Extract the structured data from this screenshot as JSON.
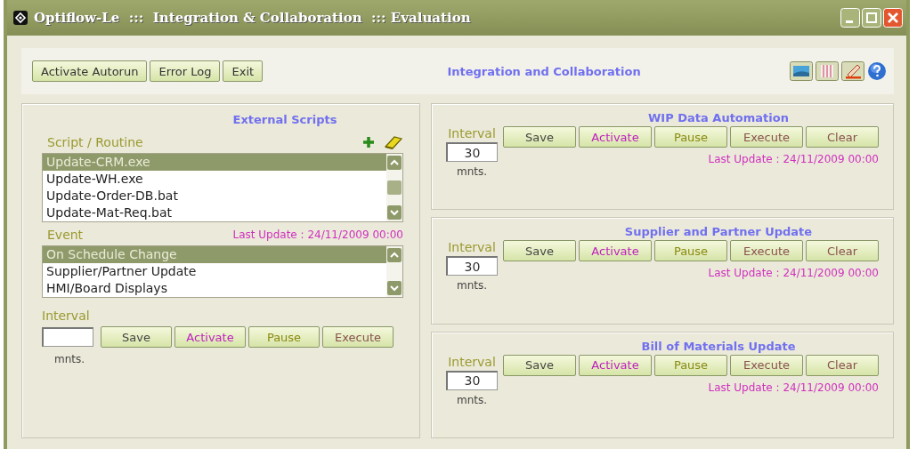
{
  "window": {
    "title": "Optiflow-Le  :::  Integration & Collaboration  ::: Evaluation"
  },
  "toolbar": {
    "buttons": [
      "Activate Autorun",
      "Error Log",
      "Exit"
    ],
    "heading": "Integration and Collaboration"
  },
  "external_scripts": {
    "title": "External Scripts",
    "list_label": "Script / Routine",
    "scripts": [
      {
        "label": "Update-CRM.exe",
        "selected": true
      },
      {
        "label": "Update-WH.exe",
        "selected": false
      },
      {
        "label": "Update-Order-DB.bat",
        "selected": false
      },
      {
        "label": "Update-Mat-Req.bat",
        "selected": false
      }
    ],
    "last_update": "Last Update : 24/11/2009 00:00",
    "event_label": "Event",
    "events": [
      {
        "label": "On Schedule Change",
        "selected": true
      },
      {
        "label": "Supplier/Partner Update",
        "selected": false
      },
      {
        "label": "HMI/Board Displays",
        "selected": false
      }
    ],
    "interval_label": "Interval",
    "unit": "mnts.",
    "buttons": [
      {
        "label": "Save",
        "kind": "save"
      },
      {
        "label": "Activate",
        "kind": "activate"
      },
      {
        "label": "Pause",
        "kind": "pause"
      },
      {
        "label": "Execute",
        "kind": "execute"
      }
    ]
  },
  "automations": [
    {
      "title": "WIP Data Automation",
      "interval_label": "Interval",
      "interval_value": "30",
      "unit": "mnts.",
      "last_update": "Last Update : 24/11/2009 00:00",
      "buttons": [
        {
          "label": "Save",
          "kind": "save"
        },
        {
          "label": "Activate",
          "kind": "activate"
        },
        {
          "label": "Pause",
          "kind": "pause"
        },
        {
          "label": "Execute",
          "kind": "execute"
        },
        {
          "label": "Clear",
          "kind": "clear"
        }
      ]
    },
    {
      "title": "Supplier and Partner Update",
      "interval_label": "Interval",
      "interval_value": "30",
      "unit": "mnts.",
      "last_update": "Last Update : 24/11/2009 00:00",
      "buttons": [
        {
          "label": "Save",
          "kind": "save"
        },
        {
          "label": "Activate",
          "kind": "activate"
        },
        {
          "label": "Pause",
          "kind": "pause"
        },
        {
          "label": "Execute",
          "kind": "execute"
        },
        {
          "label": "Clear",
          "kind": "clear"
        }
      ]
    },
    {
      "title": "Bill of Materials  Update",
      "interval_label": "Interval",
      "interval_value": "30",
      "unit": "mnts.",
      "last_update": "Last Update : 24/11/2009 00:00",
      "buttons": [
        {
          "label": "Save",
          "kind": "save"
        },
        {
          "label": "Activate",
          "kind": "activate"
        },
        {
          "label": "Pause",
          "kind": "pause"
        },
        {
          "label": "Execute",
          "kind": "execute"
        },
        {
          "label": "Clear",
          "kind": "clear"
        }
      ]
    }
  ]
}
